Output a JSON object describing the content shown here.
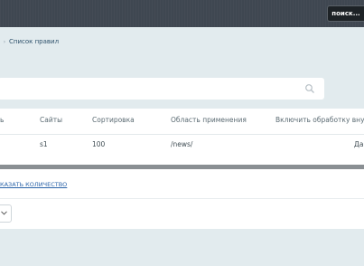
{
  "header": {
    "search_label": "поиск..."
  },
  "breadcrumb": {
    "chevron": "›",
    "current": "Список правил"
  },
  "filter": {
    "value": ""
  },
  "table": {
    "columns": [
      "ь",
      "Сайты",
      "Сортировка",
      "Область применения",
      "Включить обработку вну"
    ],
    "rows": [
      [
        "",
        "s1",
        "100",
        "/news/",
        "Да"
      ]
    ]
  },
  "footer": {
    "show_count_label": "КАЗАТЬ КОЛИЧЕСТВО"
  },
  "icons": {
    "search": "magnifier-icon",
    "pager": "chevron-down-icon"
  },
  "colors": {
    "topbar": "#3f4751",
    "link": "#2a63a8",
    "page_bg": "#e2ebee"
  }
}
